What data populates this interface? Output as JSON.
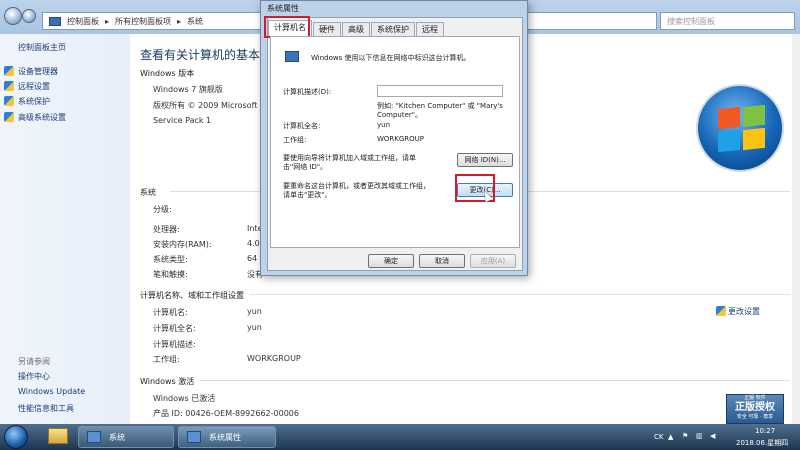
{
  "explorer": {
    "breadcrumb": [
      "控制面板",
      "所有控制面板项",
      "系统"
    ],
    "search_placeholder": "搜索控制面板"
  },
  "leftnav": {
    "home": "控制面板主页",
    "items": [
      "设备管理器",
      "远程设置",
      "系统保护",
      "高级系统设置"
    ],
    "see_also": "另请参阅",
    "see_also_items": [
      "操作中心",
      "Windows Update",
      "性能信息和工具"
    ]
  },
  "main": {
    "heading": "查看有关计算机的基本信息",
    "edition_section": "Windows 版本",
    "edition": "Windows 7 旗舰版",
    "copyright": "版权所有 © 2009 Microsoft Co",
    "service_pack": "Service Pack 1",
    "system_section": "系统",
    "system_rows": [
      {
        "label": "分级:",
        "value": ""
      },
      {
        "label": "处理器:",
        "value": "Inte"
      },
      {
        "label": "安装内存(RAM):",
        "value": "4.00"
      },
      {
        "label": "系统类型:",
        "value": "64 ("
      },
      {
        "label": "笔和触摸:",
        "value": "没有"
      }
    ],
    "computer_section": "计算机名称、域和工作组设置",
    "computer_rows": [
      {
        "label": "计算机名:",
        "value": "yun"
      },
      {
        "label": "计算机全名:",
        "value": "yun"
      },
      {
        "label": "计算机描述:",
        "value": ""
      },
      {
        "label": "工作组:",
        "value": "WORKGROUP"
      }
    ],
    "change_settings": "更改设置",
    "activation_section": "Windows 激活",
    "activation_status": "Windows 已激活",
    "product_id": "产品 ID: 00426-OEM-8992662-00006",
    "genuine": {
      "line1": "正版 软件",
      "line2": "正版授权",
      "line3": "安全 可靠 · 尊享"
    }
  },
  "dialog": {
    "title": "系统属性",
    "tabs": [
      "计算机名",
      "硬件",
      "高级",
      "系统保护",
      "远程"
    ],
    "active_tab": 0,
    "intro": "Windows 使用以下信息在网络中标识这台计算机。",
    "desc_label": "计算机描述(D):",
    "desc_value": "",
    "example_line1": "例如: \"Kitchen Computer\" 或 \"Mary's",
    "example_line2": "Computer\"。",
    "fullname_label": "计算机全名:",
    "fullname_value": "yun",
    "workgroup_label": "工作组:",
    "workgroup_value": "WORKGROUP",
    "netid_text_line1": "要使用向导将计算机加入域或工作组，请单",
    "netid_text_line2": "击\"网络 ID\"。",
    "netid_button": "网络 ID(N)...",
    "change_text_line1": "要重命名这台计算机，或者更改其域或工作组，",
    "change_text_line2": "请单击\"更改\"。",
    "change_button": "更改(C)...",
    "ok": "确定",
    "cancel": "取消",
    "apply": "应用(A)"
  },
  "taskbar": {
    "items": [
      "系统",
      "系统属性"
    ],
    "lang": "CK",
    "time": "10:27",
    "date": "2018.06.星期四"
  }
}
